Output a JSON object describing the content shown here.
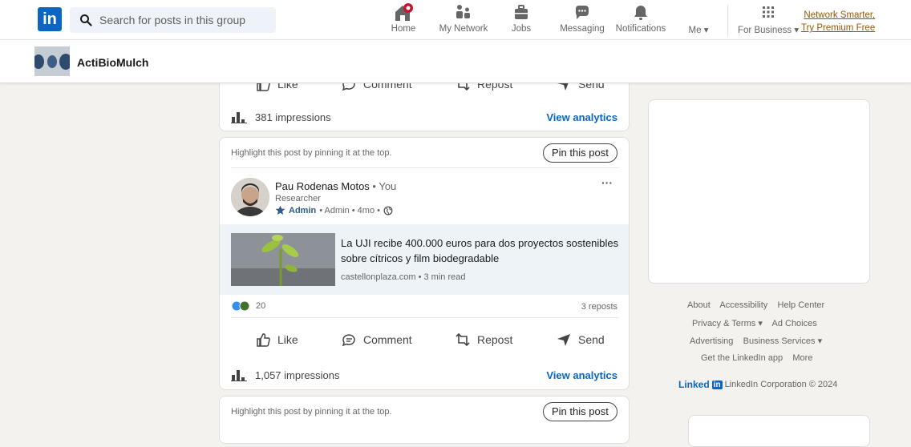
{
  "nav": {
    "logo": "in",
    "search_placeholder": "Search for posts in this group",
    "items": [
      {
        "label": "Home",
        "icon": "home-icon"
      },
      {
        "label": "My Network",
        "icon": "network-icon"
      },
      {
        "label": "Jobs",
        "icon": "briefcase-icon"
      },
      {
        "label": "Messaging",
        "icon": "messaging-icon"
      },
      {
        "label": "Notifications",
        "icon": "bell-icon"
      },
      {
        "label": "Me",
        "icon": "avatar"
      },
      {
        "label": "For Business",
        "icon": "grid-icon"
      }
    ],
    "premium_line1": "Network Smarter,",
    "premium_line2": "Try Premium Free"
  },
  "group": {
    "name": "ActiBioMulch"
  },
  "top_card": {
    "actions": [
      "Like",
      "Comment",
      "Repost",
      "Send"
    ],
    "impressions": "381 impressions",
    "analytics": "View analytics"
  },
  "post": {
    "pin_hint": "Highlight this post by pinning it at the top.",
    "pin_button": "Pin this post",
    "more": "···",
    "author": "Pau Rodenas Motos",
    "you_tag": "• You",
    "role": "Researcher",
    "admin_badge": "Admin",
    "meta": "• Admin • 4mo •",
    "article_title": "La UJI recibe 400.000 euros para dos proyectos sostenibles sobre cítricos y film biodegradable",
    "article_source": "castellonplaza.com • 3 min read",
    "reactions_count": "20",
    "reposts": "3 reposts",
    "actions": [
      "Like",
      "Comment",
      "Repost",
      "Send"
    ],
    "impressions": "1,057 impressions",
    "analytics": "View analytics"
  },
  "next_post": {
    "pin_hint": "Highlight this post by pinning it at the top.",
    "pin_button": "Pin this post"
  },
  "footer": {
    "row1": [
      "About",
      "Accessibility",
      "Help Center"
    ],
    "row2": [
      "Privacy & Terms",
      "Ad Choices"
    ],
    "row3": [
      "Advertising",
      "Business Services"
    ],
    "row4": [
      "Get the LinkedIn app",
      "More"
    ],
    "brand": "Linked",
    "brand_in": "in",
    "copyright": "LinkedIn Corporation © 2024"
  },
  "colors": {
    "accent": "#0a66c2",
    "premium": "#915907",
    "background": "#f4f2ee"
  }
}
